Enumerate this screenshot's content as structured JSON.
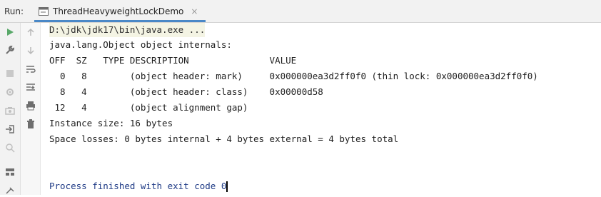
{
  "run_panel": {
    "label": "Run:",
    "tab_title": "ThreadHeavyweightLockDemo",
    "tab_close": "×"
  },
  "toolbar_icons": [
    "run-icon",
    "wrench-icon",
    "stop-icon",
    "settings-icon",
    "camera-icon",
    "login-icon",
    "search-icon",
    "layout-icon",
    "pin-icon"
  ],
  "secondary_icons": [
    "up-arrow-icon",
    "down-arrow-icon",
    "soft-wrap-icon",
    "scroll-to-end-icon",
    "print-icon",
    "trash-icon"
  ],
  "console": {
    "command": "D:\\jdk\\jdk17\\bin\\java.exe ...",
    "lines": [
      "java.lang.Object object internals:",
      "OFF  SZ   TYPE DESCRIPTION               VALUE",
      "  0   8        (object header: mark)     0x000000ea3d2ff0f0 (thin lock: 0x000000ea3d2ff0f0)",
      "  8   4        (object header: class)    0x00000d58",
      " 12   4        (object alignment gap)",
      "Instance size: 16 bytes",
      "Space losses: 0 bytes internal + 4 bytes external = 4 bytes total"
    ],
    "exit_message": "Process finished with exit code 0"
  }
}
